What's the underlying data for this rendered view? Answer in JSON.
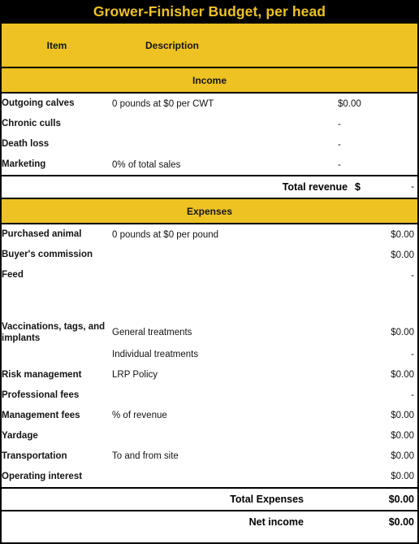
{
  "title": "Grower-Finisher Budget, per head",
  "colors": {
    "gold": "#EDC222",
    "title_bar_bg": "#000000",
    "title_text": "#EDC222",
    "border": "#000000",
    "body_bg": "#FFFFFF"
  },
  "columns": {
    "item": "Item",
    "description": "Description",
    "value": ""
  },
  "sections": {
    "income": {
      "header": "Income",
      "rows": [
        {
          "item": "Outgoing calves",
          "description": "0 pounds at $0 per CWT",
          "value": "$0.00"
        },
        {
          "item": "Chronic culls",
          "description": "",
          "value": "-"
        },
        {
          "item": "Death loss",
          "description": "",
          "value": "-"
        },
        {
          "item": "Marketing",
          "description": "0% of total sales",
          "value": "-"
        }
      ],
      "total": {
        "label": "Total revenue",
        "currency": "$",
        "value": "-"
      }
    },
    "expenses": {
      "header": "Expenses",
      "rows": [
        {
          "item": "Purchased animal",
          "description": "0 pounds at $0 per pound",
          "value": "$0.00"
        },
        {
          "item": "Buyer's commission",
          "description": "",
          "value": "$0.00"
        },
        {
          "item": "Feed",
          "description": "",
          "value": "-"
        },
        {
          "item": "Vaccinations, tags, and implants",
          "description": "General treatments",
          "value": "$0.00"
        },
        {
          "item": "",
          "description": "Individual treatments",
          "value": "-"
        },
        {
          "item": "Risk management",
          "description": "LRP Policy",
          "value": "$0.00"
        },
        {
          "item": "Professional fees",
          "description": "",
          "value": "-"
        },
        {
          "item": "Management fees",
          "description": "% of revenue",
          "value": "$0.00"
        },
        {
          "item": "Yardage",
          "description": "",
          "value": "$0.00"
        },
        {
          "item": "Transportation",
          "description": "To and from site",
          "value": "$0.00"
        },
        {
          "item": "Operating interest",
          "description": "",
          "value": "$0.00"
        }
      ],
      "total": {
        "label": "Total Expenses",
        "value": "$0.00"
      }
    },
    "net": {
      "label": "Net income",
      "value": "$0.00"
    }
  }
}
